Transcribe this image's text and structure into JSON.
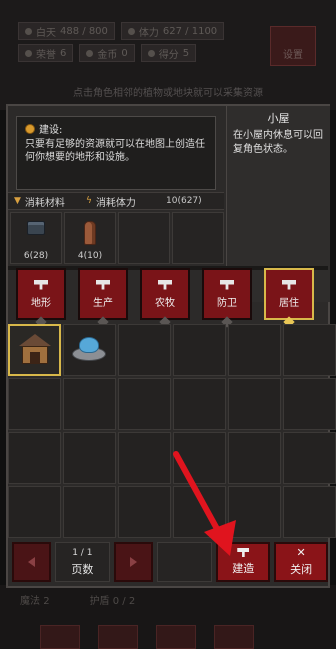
{
  "background": {
    "stats_row1": [
      {
        "label": "白天",
        "value": "488 / 800"
      },
      {
        "label": "体力",
        "value": "627 / 1100"
      }
    ],
    "stats_row2": [
      {
        "label": "荣誉",
        "value": "6"
      },
      {
        "label": "金币",
        "value": "0"
      },
      {
        "label": "得分",
        "value": "5"
      }
    ],
    "settings_label": "设置",
    "hint": "点击角色相邻的植物或地块就可以采集资源",
    "bottom_stats": [
      {
        "label": "魔法",
        "value": "2"
      },
      {
        "label": "护盾",
        "value": "0 / 2"
      }
    ]
  },
  "info": {
    "title": "建设:",
    "text": "只要有足够的资源就可以在地图上创造任何你想要的地形和设施。"
  },
  "detail": {
    "name": "小屋",
    "description": "在小屋内休息可以回复角色状态。"
  },
  "cost": {
    "materials_label": "消耗材料",
    "stamina_label": "消耗体力",
    "stamina_value": "10(627)"
  },
  "materials": [
    {
      "icon": "stone-icon",
      "count": "6(28)"
    },
    {
      "icon": "wood-icon",
      "count": "4(10)"
    },
    {
      "icon": "",
      "count": ""
    },
    {
      "icon": "",
      "count": ""
    }
  ],
  "categories": [
    {
      "label": "地形",
      "active": false
    },
    {
      "label": "生产",
      "active": false
    },
    {
      "label": "农牧",
      "active": false
    },
    {
      "label": "防卫",
      "active": false
    },
    {
      "label": "居住",
      "active": true
    }
  ],
  "items": [
    {
      "name": "cabin-icon",
      "selected": true
    },
    {
      "name": "fountain-icon",
      "selected": false
    }
  ],
  "pager": {
    "page": "1 / 1",
    "label": "页数"
  },
  "actions": {
    "build_label": "建造",
    "close_label": "关闭"
  },
  "colors": {
    "accent_red": "#8a1418",
    "selected_gold": "#d8b84a",
    "arrow_red": "#e0141e"
  }
}
